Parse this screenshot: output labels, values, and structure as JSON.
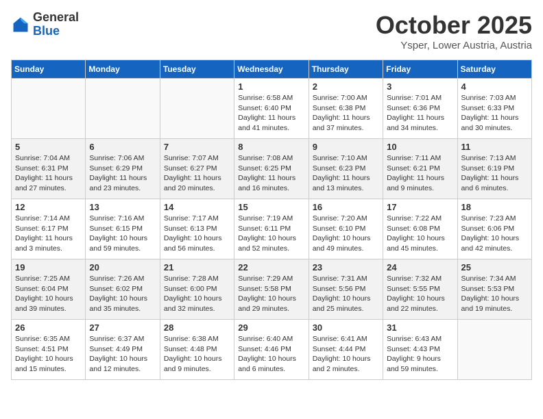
{
  "header": {
    "logo_general": "General",
    "logo_blue": "Blue",
    "month": "October 2025",
    "location": "Ysper, Lower Austria, Austria"
  },
  "days_of_week": [
    "Sunday",
    "Monday",
    "Tuesday",
    "Wednesday",
    "Thursday",
    "Friday",
    "Saturday"
  ],
  "weeks": [
    {
      "shaded": false,
      "days": [
        {
          "num": "",
          "info": ""
        },
        {
          "num": "",
          "info": ""
        },
        {
          "num": "",
          "info": ""
        },
        {
          "num": "1",
          "info": "Sunrise: 6:58 AM\nSunset: 6:40 PM\nDaylight: 11 hours\nand 41 minutes."
        },
        {
          "num": "2",
          "info": "Sunrise: 7:00 AM\nSunset: 6:38 PM\nDaylight: 11 hours\nand 37 minutes."
        },
        {
          "num": "3",
          "info": "Sunrise: 7:01 AM\nSunset: 6:36 PM\nDaylight: 11 hours\nand 34 minutes."
        },
        {
          "num": "4",
          "info": "Sunrise: 7:03 AM\nSunset: 6:33 PM\nDaylight: 11 hours\nand 30 minutes."
        }
      ]
    },
    {
      "shaded": true,
      "days": [
        {
          "num": "5",
          "info": "Sunrise: 7:04 AM\nSunset: 6:31 PM\nDaylight: 11 hours\nand 27 minutes."
        },
        {
          "num": "6",
          "info": "Sunrise: 7:06 AM\nSunset: 6:29 PM\nDaylight: 11 hours\nand 23 minutes."
        },
        {
          "num": "7",
          "info": "Sunrise: 7:07 AM\nSunset: 6:27 PM\nDaylight: 11 hours\nand 20 minutes."
        },
        {
          "num": "8",
          "info": "Sunrise: 7:08 AM\nSunset: 6:25 PM\nDaylight: 11 hours\nand 16 minutes."
        },
        {
          "num": "9",
          "info": "Sunrise: 7:10 AM\nSunset: 6:23 PM\nDaylight: 11 hours\nand 13 minutes."
        },
        {
          "num": "10",
          "info": "Sunrise: 7:11 AM\nSunset: 6:21 PM\nDaylight: 11 hours\nand 9 minutes."
        },
        {
          "num": "11",
          "info": "Sunrise: 7:13 AM\nSunset: 6:19 PM\nDaylight: 11 hours\nand 6 minutes."
        }
      ]
    },
    {
      "shaded": false,
      "days": [
        {
          "num": "12",
          "info": "Sunrise: 7:14 AM\nSunset: 6:17 PM\nDaylight: 11 hours\nand 3 minutes."
        },
        {
          "num": "13",
          "info": "Sunrise: 7:16 AM\nSunset: 6:15 PM\nDaylight: 10 hours\nand 59 minutes."
        },
        {
          "num": "14",
          "info": "Sunrise: 7:17 AM\nSunset: 6:13 PM\nDaylight: 10 hours\nand 56 minutes."
        },
        {
          "num": "15",
          "info": "Sunrise: 7:19 AM\nSunset: 6:11 PM\nDaylight: 10 hours\nand 52 minutes."
        },
        {
          "num": "16",
          "info": "Sunrise: 7:20 AM\nSunset: 6:10 PM\nDaylight: 10 hours\nand 49 minutes."
        },
        {
          "num": "17",
          "info": "Sunrise: 7:22 AM\nSunset: 6:08 PM\nDaylight: 10 hours\nand 45 minutes."
        },
        {
          "num": "18",
          "info": "Sunrise: 7:23 AM\nSunset: 6:06 PM\nDaylight: 10 hours\nand 42 minutes."
        }
      ]
    },
    {
      "shaded": true,
      "days": [
        {
          "num": "19",
          "info": "Sunrise: 7:25 AM\nSunset: 6:04 PM\nDaylight: 10 hours\nand 39 minutes."
        },
        {
          "num": "20",
          "info": "Sunrise: 7:26 AM\nSunset: 6:02 PM\nDaylight: 10 hours\nand 35 minutes."
        },
        {
          "num": "21",
          "info": "Sunrise: 7:28 AM\nSunset: 6:00 PM\nDaylight: 10 hours\nand 32 minutes."
        },
        {
          "num": "22",
          "info": "Sunrise: 7:29 AM\nSunset: 5:58 PM\nDaylight: 10 hours\nand 29 minutes."
        },
        {
          "num": "23",
          "info": "Sunrise: 7:31 AM\nSunset: 5:56 PM\nDaylight: 10 hours\nand 25 minutes."
        },
        {
          "num": "24",
          "info": "Sunrise: 7:32 AM\nSunset: 5:55 PM\nDaylight: 10 hours\nand 22 minutes."
        },
        {
          "num": "25",
          "info": "Sunrise: 7:34 AM\nSunset: 5:53 PM\nDaylight: 10 hours\nand 19 minutes."
        }
      ]
    },
    {
      "shaded": false,
      "days": [
        {
          "num": "26",
          "info": "Sunrise: 6:35 AM\nSunset: 4:51 PM\nDaylight: 10 hours\nand 15 minutes."
        },
        {
          "num": "27",
          "info": "Sunrise: 6:37 AM\nSunset: 4:49 PM\nDaylight: 10 hours\nand 12 minutes."
        },
        {
          "num": "28",
          "info": "Sunrise: 6:38 AM\nSunset: 4:48 PM\nDaylight: 10 hours\nand 9 minutes."
        },
        {
          "num": "29",
          "info": "Sunrise: 6:40 AM\nSunset: 4:46 PM\nDaylight: 10 hours\nand 6 minutes."
        },
        {
          "num": "30",
          "info": "Sunrise: 6:41 AM\nSunset: 4:44 PM\nDaylight: 10 hours\nand 2 minutes."
        },
        {
          "num": "31",
          "info": "Sunrise: 6:43 AM\nSunset: 4:43 PM\nDaylight: 9 hours\nand 59 minutes."
        },
        {
          "num": "",
          "info": ""
        }
      ]
    }
  ]
}
